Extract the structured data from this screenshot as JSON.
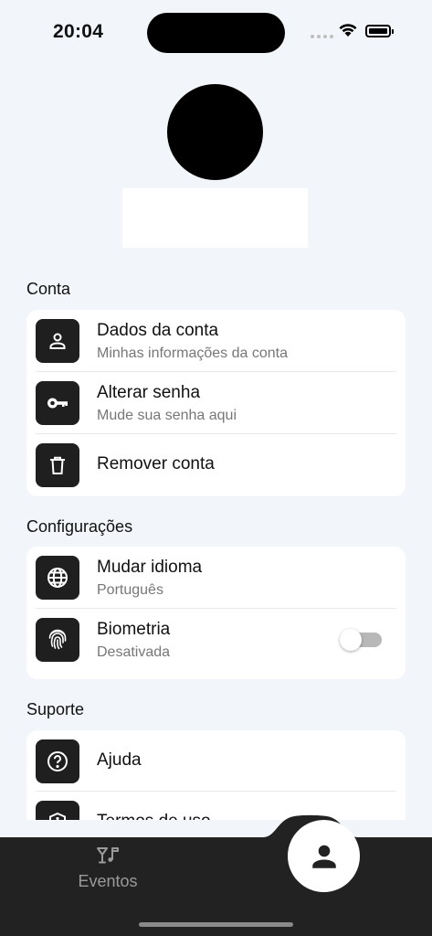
{
  "status_bar": {
    "time": "20:04"
  },
  "profile": {},
  "sections": {
    "conta": {
      "title": "Conta",
      "items": [
        {
          "title": "Dados da conta",
          "subtitle": "Minhas informações da conta",
          "icon": "person-icon"
        },
        {
          "title": "Alterar senha",
          "subtitle": "Mude sua senha aqui",
          "icon": "key-icon"
        },
        {
          "title": "Remover conta",
          "icon": "trash-icon"
        }
      ]
    },
    "configuracoes": {
      "title": "Configurações",
      "items": [
        {
          "title": "Mudar idioma",
          "subtitle": "Português",
          "icon": "globe-icon"
        },
        {
          "title": "Biometria",
          "subtitle": "Desativada",
          "icon": "fingerprint-icon",
          "toggle_on": false
        }
      ]
    },
    "suporte": {
      "title": "Suporte",
      "items": [
        {
          "title": "Ajuda",
          "icon": "help-circle-icon"
        },
        {
          "title": "Termos de uso",
          "icon": "shield-info-icon"
        }
      ]
    }
  },
  "tab_bar": {
    "events_label": "Eventos",
    "active_tab": "profile"
  },
  "colors": {
    "background": "#f2f5f9",
    "icon_box": "#1f1f1f",
    "tab_bar": "#222222",
    "muted_text": "#777777"
  }
}
